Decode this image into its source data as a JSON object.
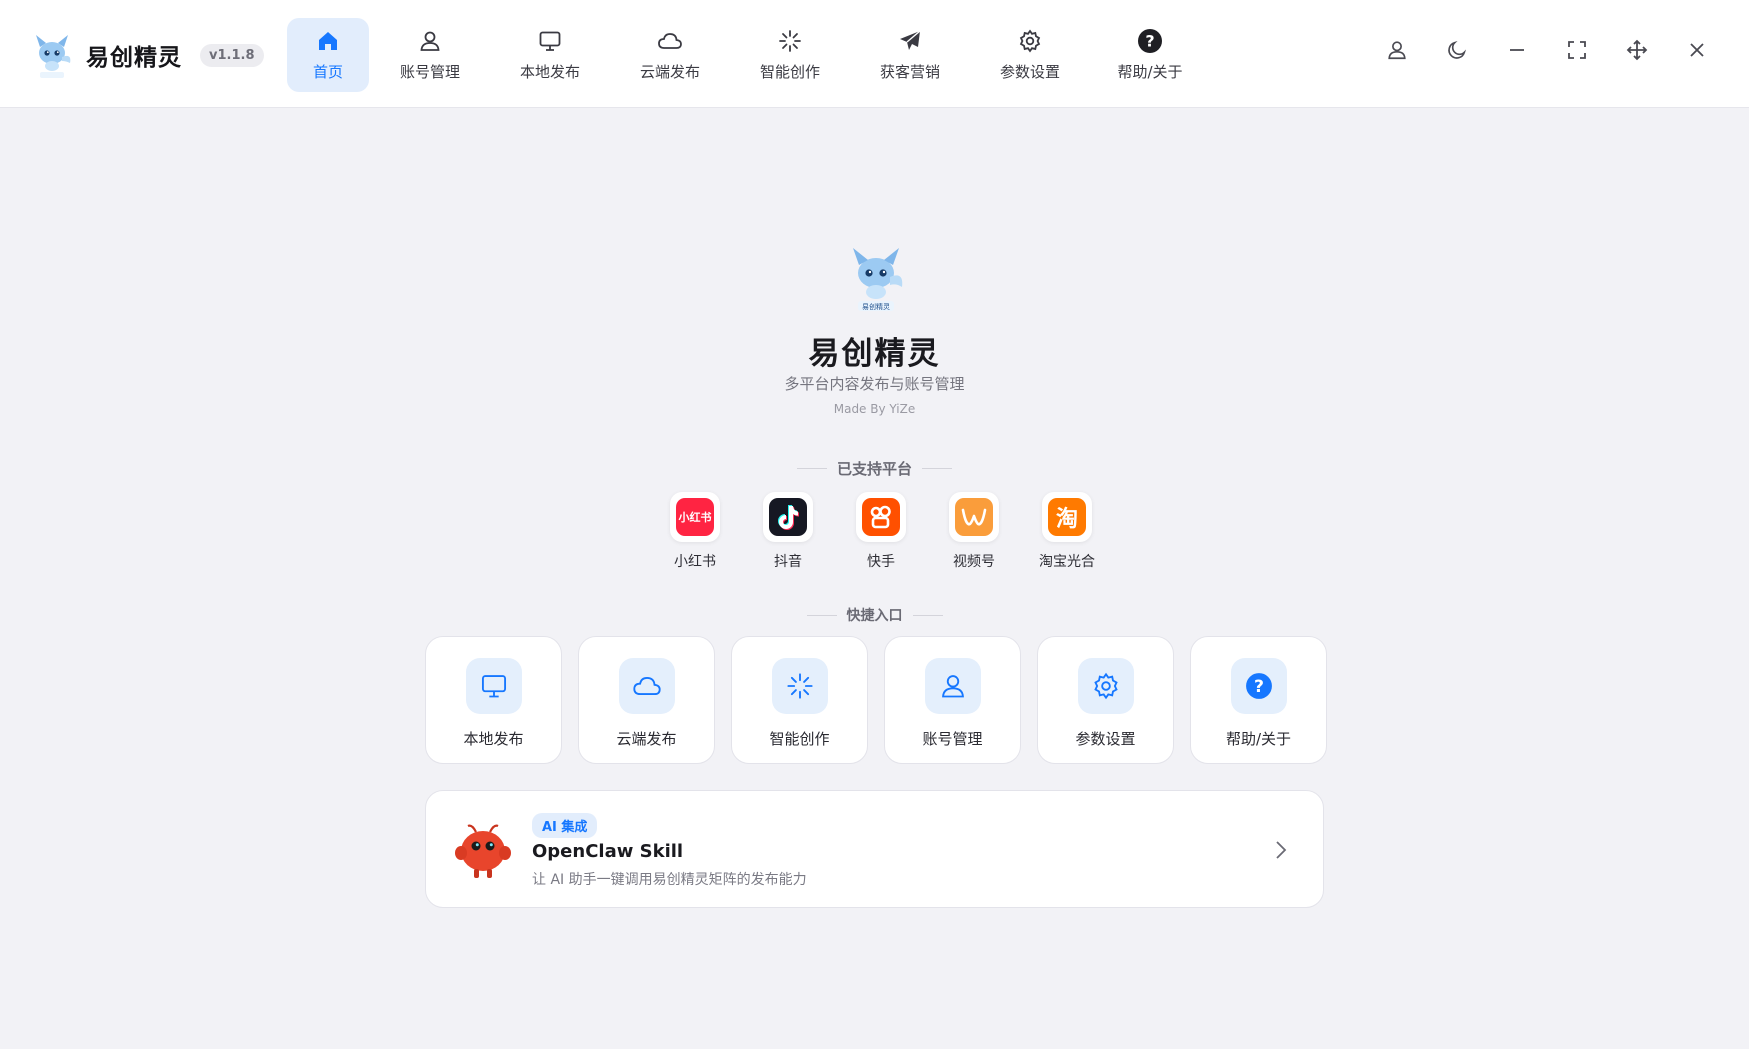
{
  "app": {
    "name": "易创精灵",
    "version": "v1.1.8"
  },
  "nav": [
    {
      "label": "首页",
      "icon": "home-icon",
      "active": true
    },
    {
      "label": "账号管理",
      "icon": "user-icon"
    },
    {
      "label": "本地发布",
      "icon": "monitor-icon"
    },
    {
      "label": "云端发布",
      "icon": "cloud-icon"
    },
    {
      "label": "智能创作",
      "icon": "sparkle-icon"
    },
    {
      "label": "获客营销",
      "icon": "send-icon"
    },
    {
      "label": "参数设置",
      "icon": "gear-icon"
    },
    {
      "label": "帮助/关于",
      "icon": "help-icon"
    }
  ],
  "window_controls": [
    "user-icon",
    "moon-icon",
    "minimize-icon",
    "fullscreen-icon",
    "move-icon",
    "close-icon"
  ],
  "hero": {
    "title": "易创精灵",
    "subtitle": "多平台内容发布与账号管理",
    "made_by": "Made By YiZe"
  },
  "platforms": {
    "label": "已支持平台",
    "items": [
      {
        "name": "小红书",
        "mark": "小红书",
        "color": "#ff2442"
      },
      {
        "name": "抖音",
        "mark": "♪",
        "color": "#161823"
      },
      {
        "name": "快手",
        "mark": "",
        "color": "#ff5000"
      },
      {
        "name": "视频号",
        "mark": "",
        "color": "#fa9d3b"
      },
      {
        "name": "淘宝光合",
        "mark": "淘",
        "color": "#ff7a00"
      }
    ]
  },
  "quick": {
    "label": "快捷入口",
    "items": [
      {
        "label": "本地发布",
        "icon": "monitor-icon"
      },
      {
        "label": "云端发布",
        "icon": "cloud-icon"
      },
      {
        "label": "智能创作",
        "icon": "sparkle-icon"
      },
      {
        "label": "账号管理",
        "icon": "user-icon"
      },
      {
        "label": "参数设置",
        "icon": "gear-icon"
      },
      {
        "label": "帮助/关于",
        "icon": "help-icon"
      }
    ]
  },
  "skill": {
    "badge": "AI 集成",
    "title": "OpenClaw Skill",
    "desc": "让 AI 助手一键调用易创精灵矩阵的发布能力"
  },
  "colors": {
    "accent": "#1677ff",
    "accent_bg": "#e2edfc",
    "page_bg": "#f2f2f6"
  }
}
